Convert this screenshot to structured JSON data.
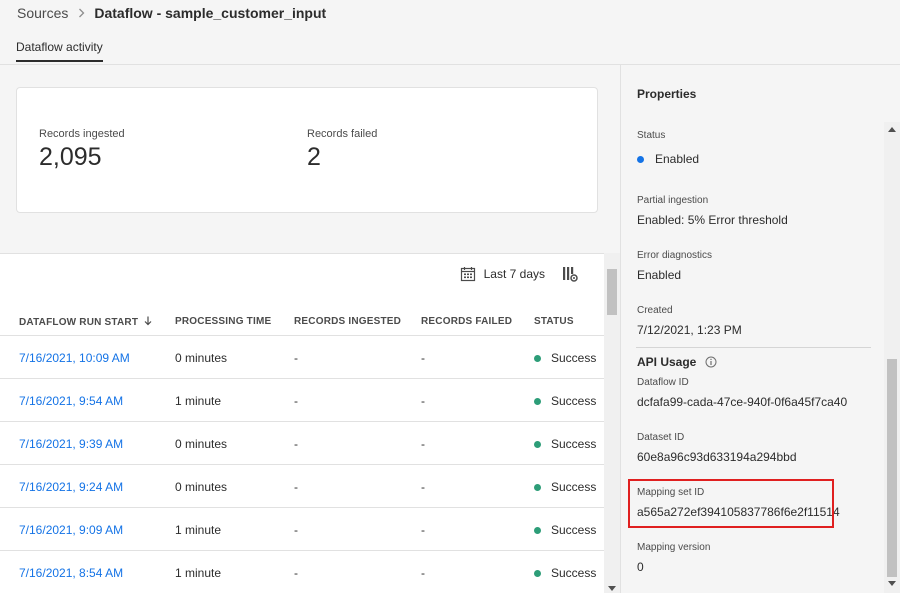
{
  "breadcrumb": {
    "parent": "Sources",
    "current": "Dataflow - sample_customer_input"
  },
  "tabs": [
    {
      "label": "Dataflow activity",
      "active": true
    }
  ],
  "metrics": {
    "ingested_label": "Records ingested",
    "ingested_value": "2,095",
    "failed_label": "Records failed",
    "failed_value": "2"
  },
  "toolbar": {
    "date_range": "Last 7 days",
    "calendar_icon": "calendar-icon",
    "column_settings_icon": "column-settings-icon"
  },
  "table": {
    "columns": [
      "DATAFLOW RUN START",
      "PROCESSING TIME",
      "RECORDS INGESTED",
      "RECORDS FAILED",
      "STATUS"
    ],
    "sort_icon": "arrow-down-icon",
    "rows": [
      {
        "run_start": "7/16/2021, 10:09 AM",
        "processing_time": "0 minutes",
        "ingested": "-",
        "failed": "-",
        "status": "Success"
      },
      {
        "run_start": "7/16/2021, 9:54 AM",
        "processing_time": "1 minute",
        "ingested": "-",
        "failed": "-",
        "status": "Success"
      },
      {
        "run_start": "7/16/2021, 9:39 AM",
        "processing_time": "0 minutes",
        "ingested": "-",
        "failed": "-",
        "status": "Success"
      },
      {
        "run_start": "7/16/2021, 9:24 AM",
        "processing_time": "0 minutes",
        "ingested": "-",
        "failed": "-",
        "status": "Success"
      },
      {
        "run_start": "7/16/2021, 9:09 AM",
        "processing_time": "1 minute",
        "ingested": "-",
        "failed": "-",
        "status": "Success"
      },
      {
        "run_start": "7/16/2021, 8:54 AM",
        "processing_time": "1 minute",
        "ingested": "-",
        "failed": "-",
        "status": "Success"
      }
    ]
  },
  "properties": {
    "title": "Properties",
    "status_label": "Status",
    "status_value": "Enabled",
    "partial_label": "Partial ingestion",
    "partial_value": "Enabled: 5% Error threshold",
    "error_diag_label": "Error diagnostics",
    "error_diag_value": "Enabled",
    "created_label": "Created",
    "created_value": "7/12/2021, 1:23 PM",
    "api_title": "API Usage",
    "dataflow_id_label": "Dataflow ID",
    "dataflow_id_value": "dcfafa99-cada-47ce-940f-0f6a45f7ca40",
    "dataset_id_label": "Dataset ID",
    "dataset_id_value": "60e8a96c93d633194a294bbd",
    "mapping_set_label": "Mapping set ID",
    "mapping_set_value": "a565a272ef394105837786f6e2f11514",
    "mapping_version_label": "Mapping version",
    "mapping_version_value": "0"
  },
  "colors": {
    "link": "#1473e6",
    "success": "#2d9d78",
    "enabled": "#1473e6",
    "highlight": "#e02020"
  }
}
